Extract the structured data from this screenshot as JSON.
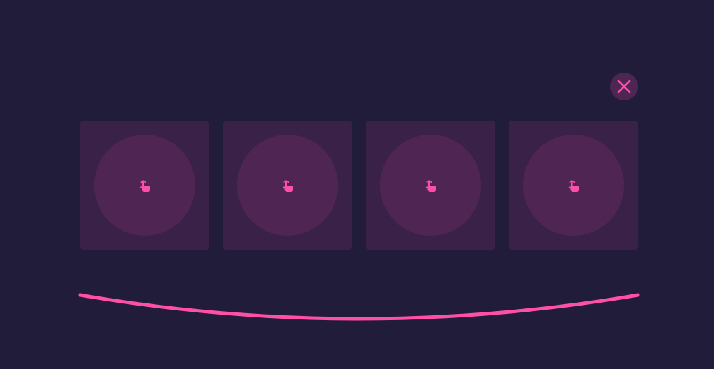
{
  "colors": {
    "background": "#201c39",
    "accent": "#ff4fa7",
    "card": "#3a2147",
    "card_circle": "#4f2653",
    "close_bg": "#4e2653"
  },
  "close_button": {
    "icon": "close-icon"
  },
  "cards": [
    {
      "icon": "tap-hand-icon"
    },
    {
      "icon": "tap-hand-icon"
    },
    {
      "icon": "tap-hand-icon"
    },
    {
      "icon": "tap-hand-icon"
    }
  ]
}
